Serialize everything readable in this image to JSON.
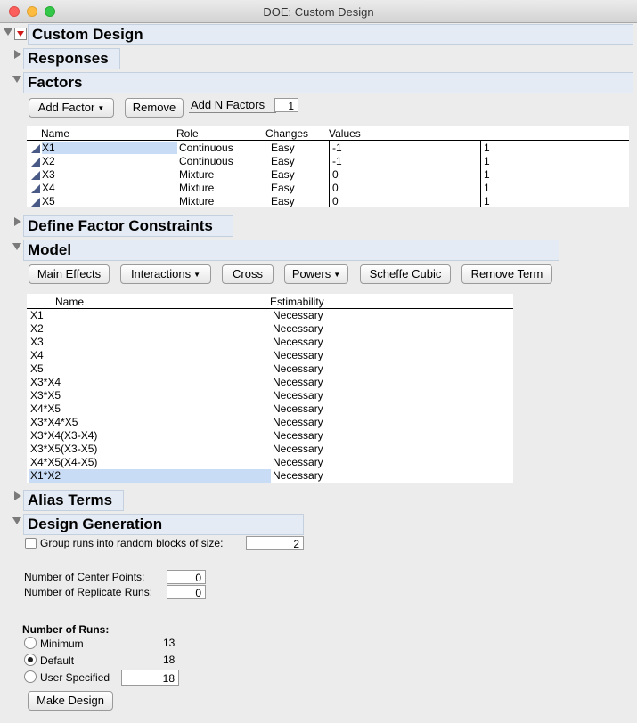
{
  "window": {
    "title": "DOE: Custom Design"
  },
  "sections": {
    "custom_design": "Custom Design",
    "responses": "Responses",
    "factors": "Factors",
    "define_factor_constraints": "Define Factor Constraints",
    "model": "Model",
    "alias_terms": "Alias Terms",
    "design_generation": "Design Generation"
  },
  "factors": {
    "add_factor_label": "Add Factor",
    "remove_label": "Remove",
    "add_n_label": "Add N Factors",
    "add_n_value": "1",
    "columns": [
      "Name",
      "Role",
      "Changes",
      "Values"
    ],
    "rows": [
      {
        "name": "X1",
        "role": "Continuous",
        "changes": "Easy",
        "low": "-1",
        "high": "1"
      },
      {
        "name": "X2",
        "role": "Continuous",
        "changes": "Easy",
        "low": "-1",
        "high": "1"
      },
      {
        "name": "X3",
        "role": "Mixture",
        "changes": "Easy",
        "low": "0",
        "high": "1"
      },
      {
        "name": "X4",
        "role": "Mixture",
        "changes": "Easy",
        "low": "0",
        "high": "1"
      },
      {
        "name": "X5",
        "role": "Mixture",
        "changes": "Easy",
        "low": "0",
        "high": "1"
      }
    ]
  },
  "model": {
    "buttons": {
      "main_effects": "Main Effects",
      "interactions": "Interactions",
      "cross": "Cross",
      "powers": "Powers",
      "scheffe_cubic": "Scheffe Cubic",
      "remove_term": "Remove Term"
    },
    "columns": [
      "Name",
      "Estimability"
    ],
    "terms": [
      {
        "name": "X1",
        "estimability": "Necessary"
      },
      {
        "name": "X2",
        "estimability": "Necessary"
      },
      {
        "name": "X3",
        "estimability": "Necessary"
      },
      {
        "name": "X4",
        "estimability": "Necessary"
      },
      {
        "name": "X5",
        "estimability": "Necessary"
      },
      {
        "name": "X3*X4",
        "estimability": "Necessary"
      },
      {
        "name": "X3*X5",
        "estimability": "Necessary"
      },
      {
        "name": "X4*X5",
        "estimability": "Necessary"
      },
      {
        "name": "X3*X4*X5",
        "estimability": "Necessary"
      },
      {
        "name": "X3*X4(X3-X4)",
        "estimability": "Necessary"
      },
      {
        "name": "X3*X5(X3-X5)",
        "estimability": "Necessary"
      },
      {
        "name": "X4*X5(X4-X5)",
        "estimability": "Necessary"
      },
      {
        "name": "X1*X2",
        "estimability": "Necessary"
      }
    ]
  },
  "design_generation": {
    "group_runs_label": "Group runs into random blocks of size:",
    "group_runs_value": "2",
    "center_points_label": "Number of Center Points:",
    "center_points_value": "0",
    "replicate_runs_label": "Number of Replicate Runs:",
    "replicate_runs_value": "0",
    "runs_heading": "Number of Runs:",
    "minimum_label": "Minimum",
    "minimum_value": "13",
    "default_label": "Default",
    "default_value": "18",
    "user_specified_label": "User Specified",
    "user_specified_value": "18",
    "make_design_label": "Make Design"
  },
  "colors": {
    "selection": "#c8dcf5",
    "header_bg": "#e4ebf4",
    "red_triangle": "#d01818"
  }
}
